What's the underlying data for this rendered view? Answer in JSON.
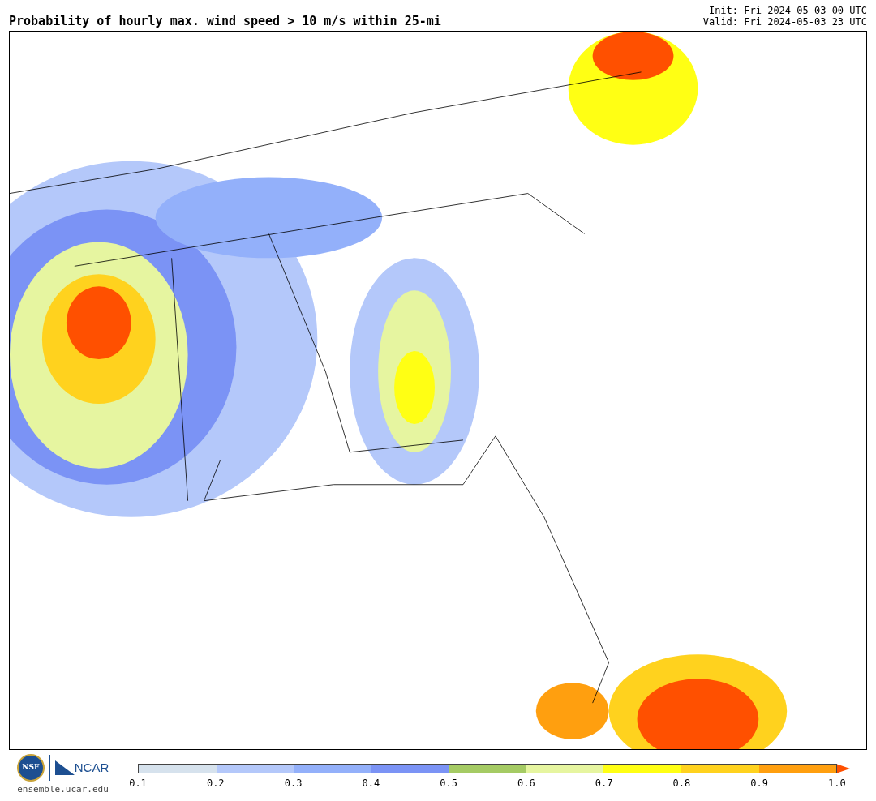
{
  "title": "Probability of hourly max. wind speed > 10 m/s within 25-mi",
  "init": "Init: Fri 2024-05-03 00 UTC",
  "valid": "Valid: Fri 2024-05-03 23 UTC",
  "logos": {
    "nsf": "NSF",
    "ncar": "NCAR",
    "url": "ensemble.ucar.edu"
  },
  "colorbar": {
    "segments": [
      {
        "color": "#d6e2ed"
      },
      {
        "color": "#b4c8fa"
      },
      {
        "color": "#93b0fa"
      },
      {
        "color": "#7b93f5"
      },
      {
        "color": "#a5cb64"
      },
      {
        "color": "#e6f5a0"
      },
      {
        "color": "#ffff14"
      },
      {
        "color": "#ffd21e"
      },
      {
        "color": "#ff9f0f"
      },
      {
        "color": "#ff5000",
        "kind": "arrow"
      }
    ],
    "ticks": [
      "0.1",
      "0.2",
      "0.3",
      "0.4",
      "0.5",
      "0.6",
      "0.7",
      "0.8",
      "0.9",
      "1.0"
    ]
  }
}
